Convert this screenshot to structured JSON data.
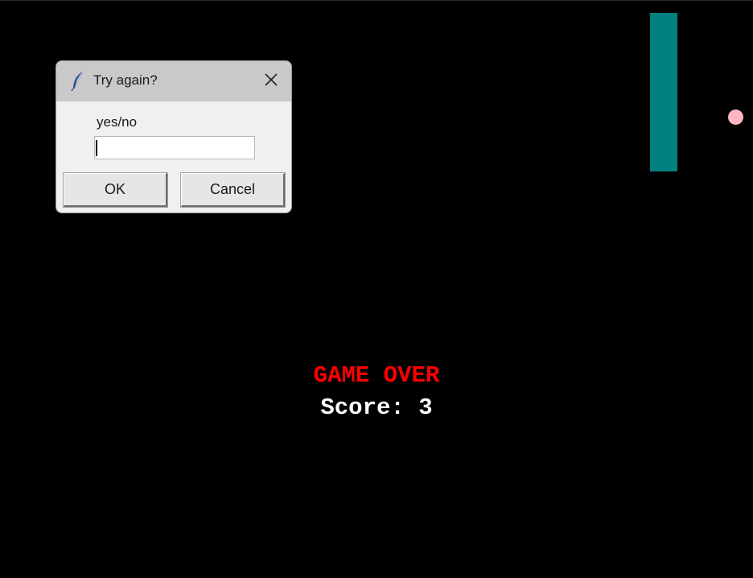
{
  "game": {
    "game_over_label": "GAME OVER",
    "score_label": "Score: 3",
    "colors": {
      "background": "#000000",
      "paddle": "#008080",
      "ball": "#ffb6c1",
      "game_over": "#ff0000",
      "score": "#ffffff"
    }
  },
  "dialog": {
    "title": "Try again?",
    "title_icon": "feather-icon",
    "close_icon": "close-icon",
    "prompt": "yes/no",
    "input_value": "",
    "ok_label": "OK",
    "cancel_label": "Cancel"
  }
}
